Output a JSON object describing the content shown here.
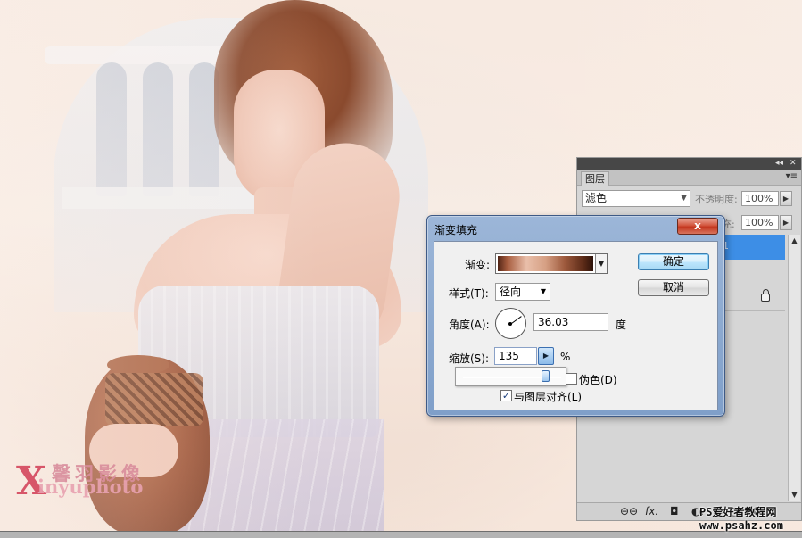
{
  "watermark": {
    "x_letter": "X",
    "cn": "馨羽影像",
    "en": "inyuphoto"
  },
  "site_watermark": {
    "line1": "PS爱好者教程网",
    "line2": "www.psahz.com"
  },
  "layers_panel": {
    "collapse_glyph": "◂◂",
    "close_glyph": "✕",
    "tab": "图层",
    "menu_glyph": "▾≡",
    "blend_mode": "滤色",
    "opacity_label": "不透明度:",
    "opacity_value": "100%",
    "fill_label": "充:",
    "fill_value": "100%",
    "layer_name": "1",
    "bottom_icons": [
      "⊖⊖",
      "fx.",
      "◘",
      "◐.",
      "▭",
      "▢",
      "✖"
    ]
  },
  "dialog": {
    "title": "渐变填充",
    "close_label": "x",
    "gradient_label": "渐变:",
    "style_label": "样式(T):",
    "style_value": "径向",
    "angle_label": "角度(A):",
    "angle_value": "36.03",
    "angle_unit": "度",
    "scale_label": "缩放(S):",
    "scale_value": "135",
    "scale_unit": "%",
    "scale_slider_fraction": 0.9,
    "dither_label": "伪色(D)",
    "dither_checked": false,
    "align_label": "与图层对齐(L)",
    "align_checked": true,
    "ok_label": "确定",
    "cancel_label": "取消",
    "gradient_colors": [
      "#4f2314",
      "#e9bfaa",
      "#2c120a"
    ]
  }
}
